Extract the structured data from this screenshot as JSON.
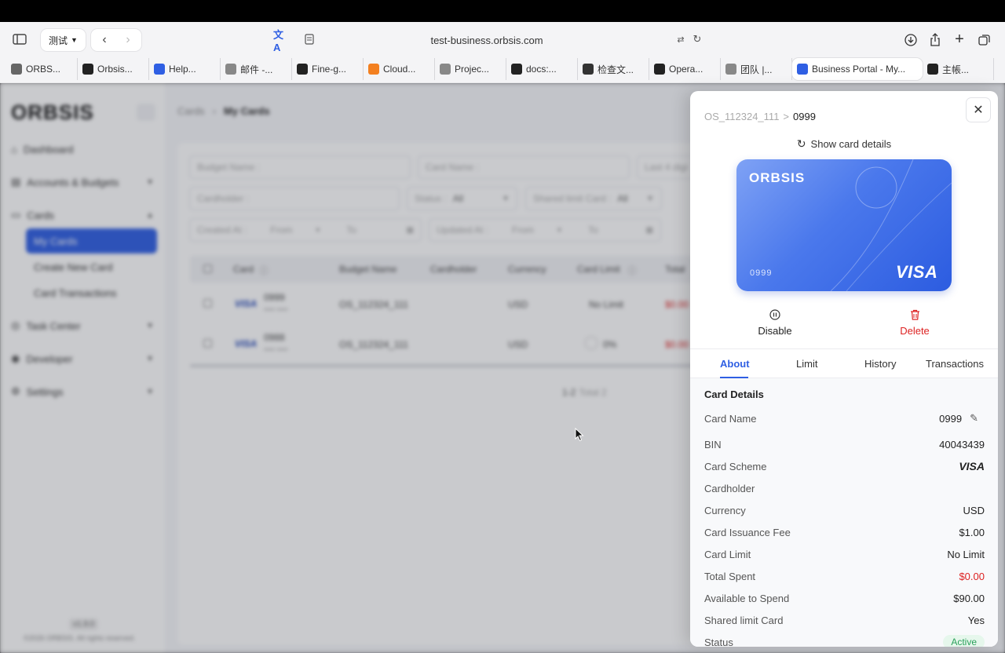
{
  "browser": {
    "group_label": "测试",
    "url": "test-business.orbsis.com",
    "tabs": [
      {
        "label": "ORBS...",
        "color": "#666"
      },
      {
        "label": "Orbsis...",
        "color": "#222"
      },
      {
        "label": "Help...",
        "color": "#2f5fe3"
      },
      {
        "label": "邮件 -...",
        "color": "#888"
      },
      {
        "label": "Fine-g...",
        "color": "#222"
      },
      {
        "label": "Cloud...",
        "color": "#f38020"
      },
      {
        "label": "Projec...",
        "color": "#888"
      },
      {
        "label": "docs:...",
        "color": "#222"
      },
      {
        "label": "检查文...",
        "color": "#333"
      },
      {
        "label": "Opera...",
        "color": "#222"
      },
      {
        "label": "团队 |...",
        "color": "#888"
      },
      {
        "label": "Business Portal - My...",
        "color": "#2f5fe3"
      },
      {
        "label": "主帳...",
        "color": "#222"
      }
    ]
  },
  "sidebar": {
    "logo": "ORBSIS",
    "items": {
      "dashboard": "Dashboard",
      "accounts": "Accounts & Budgets",
      "cards": "Cards",
      "my_cards": "My Cards",
      "create_card": "Create New Card",
      "card_transactions": "Card Transactions",
      "task_center": "Task Center",
      "developer": "Developer",
      "settings": "Settings"
    },
    "version": "v1.9.0",
    "copyright": "©2026 ORBSIS. All rights reserved."
  },
  "main": {
    "breadcrumb": {
      "parent": "Cards",
      "current": "My Cards"
    },
    "filters": {
      "budget_name": "Budget Name :",
      "card_name": "Card Name :",
      "last4": "Last 4 digi",
      "cardholder": "Cardholder :",
      "status_label": "Status :",
      "status_value": "All",
      "shared_label": "Shared limit Card :",
      "shared_value": "All",
      "created_label": "Created At :",
      "updated_label": "Updated At :",
      "from": "From",
      "to": "To"
    },
    "table": {
      "headers": [
        "Card",
        "Budget Name",
        "Cardholder",
        "Currency",
        "Card Limit",
        "Total"
      ],
      "rows": [
        {
          "name": "0999",
          "masked": "**** ****",
          "budget": "OS_112324_111",
          "currency": "USD",
          "limit": "No Limit",
          "total": "$0.00"
        },
        {
          "name": "0988",
          "masked": "**** ****",
          "budget": "OS_112324_111",
          "currency": "USD",
          "limit": "0%",
          "total": "$0.00"
        }
      ],
      "brand": "VISA"
    },
    "pager": {
      "range": "1-2",
      "total": "Total 2"
    }
  },
  "drawer": {
    "breadcrumb": {
      "parent": "OS_112324_111",
      "current": "0999"
    },
    "show_details": "Show card details",
    "card": {
      "logo": "ORBSIS",
      "number": "0999",
      "brand": "VISA"
    },
    "actions": {
      "disable": "Disable",
      "delete": "Delete"
    },
    "tabs": [
      "About",
      "Limit",
      "History",
      "Transactions"
    ],
    "section_title": "Card Details",
    "details": [
      {
        "key": "Card Name",
        "value": "0999"
      },
      {
        "key": "BIN",
        "value": "40043439"
      },
      {
        "key": "Card Scheme",
        "value": "VISA"
      },
      {
        "key": "Cardholder",
        "value": ""
      },
      {
        "key": "Currency",
        "value": "USD"
      },
      {
        "key": "Card Issuance Fee",
        "value": "$1.00"
      },
      {
        "key": "Card Limit",
        "value": "No Limit"
      },
      {
        "key": "Total Spent",
        "value": "$0.00"
      },
      {
        "key": "Available to Spend",
        "value": "$90.00"
      },
      {
        "key": "Shared limit Card",
        "value": "Yes"
      },
      {
        "key": "Status",
        "value": "Active"
      }
    ],
    "colors": {
      "accent": "#2f5fe3",
      "danger": "#dd2222",
      "success": "#2aa05a"
    }
  }
}
